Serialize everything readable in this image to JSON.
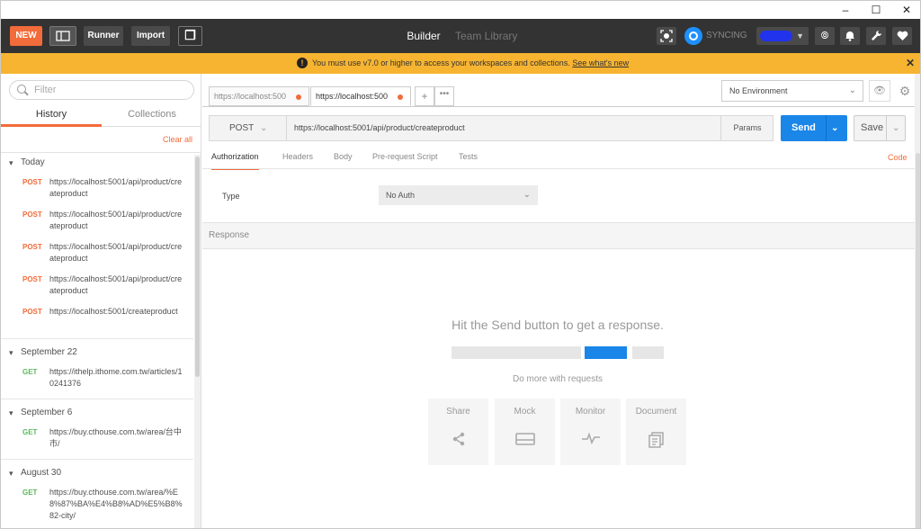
{
  "window": {
    "minimize": "–",
    "maximize": "☐",
    "close": "✕"
  },
  "header": {
    "new_label": "NEW",
    "runner_label": "Runner",
    "import_label": "Import",
    "new_tab_glyph": "❐",
    "tabs": [
      {
        "label": "Builder",
        "active": true
      },
      {
        "label": "Team Library",
        "active": false
      }
    ],
    "sync_label": "SYNCING",
    "icons": [
      "capture-icon",
      "sync-icon",
      "user-menu",
      "satellite-icon",
      "bell-icon",
      "wrench-icon",
      "heart-icon"
    ],
    "accent_color": "#f26b3a"
  },
  "banner": {
    "text": "You must use v7.0 or higher to access your workspaces and collections.",
    "link": "See what's new",
    "close": "✕",
    "color": "#f7b431"
  },
  "sidebar": {
    "search_placeholder": "Filter",
    "tabs": [
      {
        "label": "History",
        "active": true
      },
      {
        "label": "Collections",
        "active": false
      }
    ],
    "clear_all": "Clear all",
    "groups": [
      {
        "title": "Today",
        "items": [
          {
            "method": "POST",
            "url": "https://localhost:5001/api/product/createproduct"
          },
          {
            "method": "POST",
            "url": "https://localhost:5001/api/product/createproduct"
          },
          {
            "method": "POST",
            "url": "https://localhost:5001/api/product/createproduct"
          },
          {
            "method": "POST",
            "url": "https://localhost:5001/api/product/createproduct"
          },
          {
            "method": "POST",
            "url": "https://localhost:5001/createproduct"
          }
        ]
      },
      {
        "title": "September 22",
        "items": [
          {
            "method": "GET",
            "url": "https://ithelp.ithome.com.tw/articles/10241376"
          }
        ]
      },
      {
        "title": "September 6",
        "items": [
          {
            "method": "GET",
            "url": "https://buy.cthouse.com.tw/area/台中市/"
          }
        ]
      },
      {
        "title": "August 30",
        "items": [
          {
            "method": "GET",
            "url": "https://buy.cthouse.com.tw/area/%E8%87%BA%E4%B8%AD%E5%B8%82-city/"
          }
        ]
      }
    ]
  },
  "main": {
    "request_tabs": [
      {
        "label": "https://localhost:500",
        "active": false
      },
      {
        "label": "https://localhost:500",
        "active": true
      }
    ],
    "add_tab": "+",
    "more_tabs": "•••",
    "environment": "No Environment",
    "method": "POST",
    "url": "https://localhost:5001/api/product/createproduct",
    "params_label": "Params",
    "send_label": "Send",
    "save_label": "Save",
    "subtabs": [
      "Authorization",
      "Headers",
      "Body",
      "Pre-request Script",
      "Tests"
    ],
    "code_label": "Code",
    "type_label": "Type",
    "auth_value": "No Auth",
    "response_label": "Response",
    "empty_title": "Hit the Send button to get a response.",
    "do_more": "Do more with requests",
    "cards": [
      {
        "label": "Share",
        "icon": "share-icon"
      },
      {
        "label": "Mock",
        "icon": "mock-icon"
      },
      {
        "label": "Monitor",
        "icon": "monitor-icon"
      },
      {
        "label": "Document",
        "icon": "document-icon"
      }
    ],
    "primary_color": "#1a86e8"
  }
}
